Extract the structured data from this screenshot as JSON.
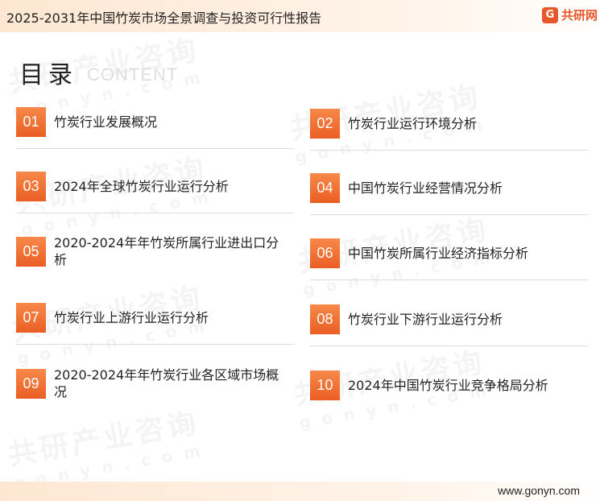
{
  "header": {
    "title": "2025-2031年中国竹炭市场全景调查与投资可行性报告",
    "logo_mark": "G",
    "logo_text": "共研网"
  },
  "watermark": {
    "brand": "共研产业咨询",
    "url": "gonyn.com"
  },
  "toc": {
    "heading": "目录",
    "subheading": "CONTENT",
    "items": [
      {
        "num": "01",
        "label": "竹炭行业发展概况"
      },
      {
        "num": "02",
        "label": "竹炭行业运行环境分析"
      },
      {
        "num": "03",
        "label": "2024年全球竹炭行业运行分析"
      },
      {
        "num": "04",
        "label": "中国竹炭行业经营情况分析"
      },
      {
        "num": "05",
        "label": "2020-2024年年竹炭所属行业进出口分析"
      },
      {
        "num": "06",
        "label": "中国竹炭所属行业经济指标分析"
      },
      {
        "num": "07",
        "label": "竹炭行业上游行业运行分析"
      },
      {
        "num": "08",
        "label": "竹炭行业下游行业运行分析"
      },
      {
        "num": "09",
        "label": "2020-2024年年竹炭行业各区域市场概况"
      },
      {
        "num": "10",
        "label": "2024年中国竹炭行业竞争格局分析"
      }
    ]
  },
  "footer": {
    "url": "www.gonyn.com"
  },
  "colors": {
    "accent": "#ea5e23",
    "header_bg": "#fde7d2"
  }
}
